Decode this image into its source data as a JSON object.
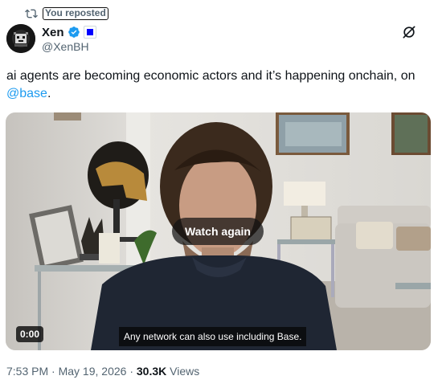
{
  "repost": {
    "label": "You reposted"
  },
  "author": {
    "name": "Xen",
    "handle": "@XenBH"
  },
  "tweet": {
    "text": "ai agents are becoming economic actors and it’s happening onchain, on",
    "mention": "@base",
    "end": "."
  },
  "media": {
    "watch_again_label": "Watch again",
    "timestamp": "0:00",
    "caption": "Any network can also use including Base."
  },
  "meta": {
    "time": "7:53 PM",
    "separator": " · ",
    "date": "May 19, 2026",
    "views_count": "30.3K",
    "views_label": " Views"
  },
  "colors": {
    "accent": "#1d9bf0",
    "verified": "#1d9bf0",
    "secondary_text": "#536471"
  },
  "icons": [
    "repost-icon",
    "verified-icon",
    "affiliate-badge-icon",
    "grok-icon"
  ]
}
